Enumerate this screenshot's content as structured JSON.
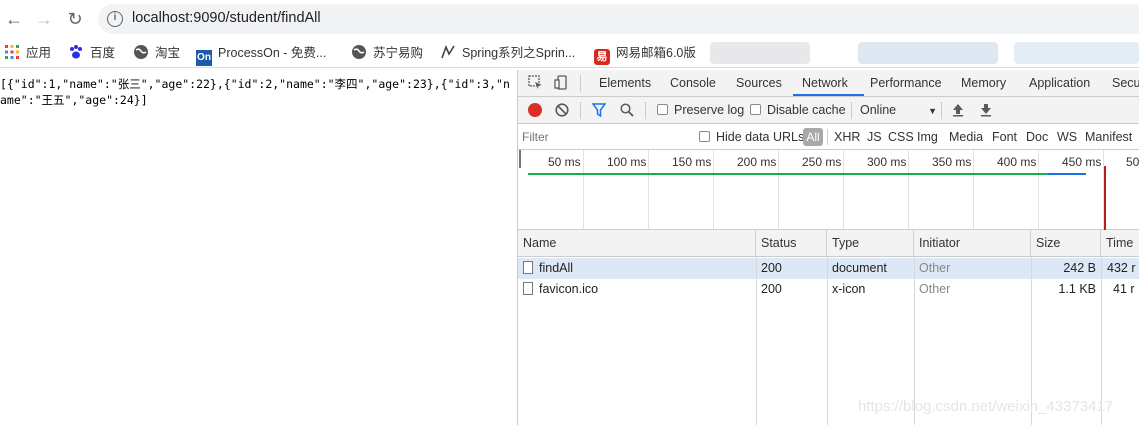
{
  "browser": {
    "url": "localhost:9090/student/findAll",
    "bookmarks": [
      {
        "label": "应用",
        "icon": "apps-grid-icon"
      },
      {
        "label": "百度",
        "icon": "baidu-paw-icon"
      },
      {
        "label": "淘宝",
        "icon": "globe-icon"
      },
      {
        "label": "ProcessOn - 免费...",
        "icon": "processon-icon"
      },
      {
        "label": "苏宁易购",
        "icon": "globe-icon"
      },
      {
        "label": "Spring系列之Sprin...",
        "icon": "spring-leaf-icon"
      },
      {
        "label": "网易邮箱6.0版",
        "icon": "netease-mail-icon"
      }
    ]
  },
  "page": {
    "json_text": "[{\"id\":1,\"name\":\"张三\",\"age\":22},{\"id\":2,\"name\":\"李四\",\"age\":23},{\"id\":3,\"name\":\"王五\",\"age\":24}]"
  },
  "devtools": {
    "tabs": [
      "Elements",
      "Console",
      "Sources",
      "Network",
      "Performance",
      "Memory",
      "Application",
      "Secu"
    ],
    "active_tab": "Network",
    "controls": {
      "preserve_log": "Preserve log",
      "disable_cache": "Disable cache",
      "throttle": "Online"
    },
    "filter": {
      "placeholder": "Filter",
      "hide_data_urls": "Hide data URLs",
      "all": "All",
      "types": [
        "XHR",
        "JS",
        "CSS",
        "Img",
        "Media",
        "Font",
        "Doc",
        "WS",
        "Manifest"
      ]
    },
    "timeline_ticks": [
      "50 ms",
      "100 ms",
      "150 ms",
      "200 ms",
      "250 ms",
      "300 ms",
      "350 ms",
      "400 ms",
      "450 ms",
      "50"
    ],
    "columns": [
      "Name",
      "Status",
      "Type",
      "Initiator",
      "Size",
      "Time"
    ],
    "rows": [
      {
        "name": "findAll",
        "status": "200",
        "type": "document",
        "initiator": "Other",
        "size": "242 B",
        "time": "432 r"
      },
      {
        "name": "favicon.ico",
        "status": "200",
        "type": "x-icon",
        "initiator": "Other",
        "size": "1.1 KB",
        "time": "41 r"
      }
    ]
  },
  "watermark": "https://blog.csdn.net/weixin_43373417",
  "colors": {
    "accent_blue": "#1a73e8",
    "record_red": "#d93025",
    "selected_row": "#dde8f6",
    "green_bar": "#15b24b"
  }
}
